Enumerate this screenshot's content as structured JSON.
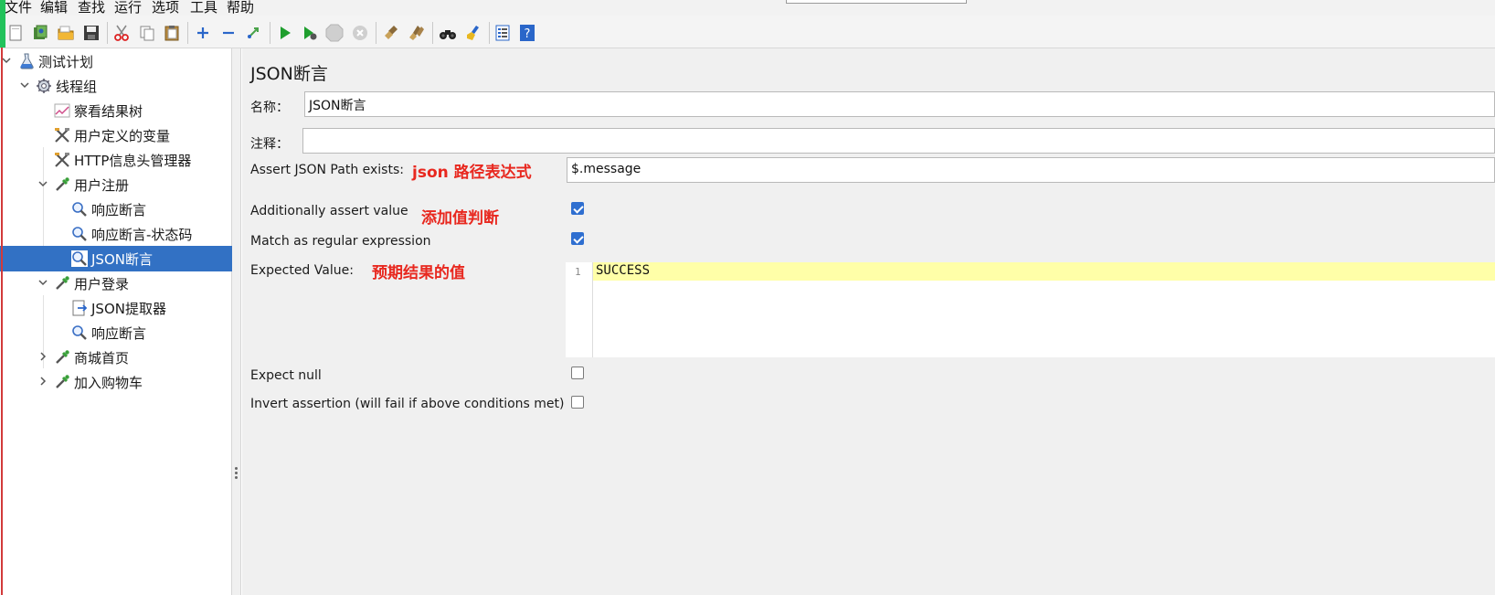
{
  "menu": [
    "文件",
    "编辑",
    "查找",
    "运行",
    "选项",
    "工具",
    "帮助"
  ],
  "toolbar": {
    "icons": [
      "new-icon",
      "templates-icon",
      "open-icon",
      "save-icon",
      "cut-icon",
      "copy-icon",
      "paste-icon",
      "expand-icon",
      "collapse-icon",
      "toggle-icon",
      "start-icon",
      "start-no-pause-icon",
      "stop-icon",
      "shutdown-icon",
      "clear-icon",
      "clear-all-icon",
      "search-icon",
      "reset-search-icon",
      "function-helper-icon",
      "help-icon"
    ]
  },
  "tree": {
    "nodes": [
      {
        "label": "测试计划",
        "icon": "test-plan-icon",
        "level": 0,
        "expanded": true
      },
      {
        "label": "线程组",
        "icon": "thread-group-gear-icon",
        "level": 1,
        "expanded": true
      },
      {
        "label": "察看结果树",
        "icon": "listener-graph-icon",
        "level": 2
      },
      {
        "label": "用户定义的变量",
        "icon": "config-tools-icon",
        "level": 2
      },
      {
        "label": "HTTP信息头管理器",
        "icon": "config-tools-icon",
        "level": 2
      },
      {
        "label": "用户注册",
        "icon": "sampler-pipette-icon",
        "level": 2,
        "expanded": true
      },
      {
        "label": "响应断言",
        "icon": "assertion-magnifier-icon",
        "level": 3
      },
      {
        "label": "响应断言-状态码",
        "icon": "assertion-magnifier-icon",
        "level": 3
      },
      {
        "label": "JSON断言",
        "icon": "assertion-magnifier-icon",
        "level": 3,
        "selected": true
      },
      {
        "label": "用户登录",
        "icon": "sampler-pipette-icon",
        "level": 2,
        "expanded": true
      },
      {
        "label": "JSON提取器",
        "icon": "post-processor-icon",
        "level": 3
      },
      {
        "label": "响应断言",
        "icon": "assertion-magnifier-icon",
        "level": 3
      },
      {
        "label": "商城首页",
        "icon": "sampler-pipette-icon",
        "level": 2,
        "expanded": false
      },
      {
        "label": "加入购物车",
        "icon": "sampler-pipette-icon",
        "level": 2,
        "expanded": false
      }
    ]
  },
  "panel": {
    "title": "JSON断言",
    "name_label": "名称：",
    "name_value": "JSON断言",
    "comment_label": "注释：",
    "comment_value": "",
    "json_path_label": "Assert JSON Path exists:",
    "json_path_value": "$.message",
    "json_path_annotation": "json 路径表达式",
    "assert_value_label": "Additionally assert value",
    "assert_value_checked": true,
    "assert_value_annotation": "添加值判断",
    "regex_label": "Match as regular expression",
    "regex_checked": true,
    "expected_label": "Expected Value:",
    "expected_annotation": "预期结果的值",
    "expected_line_number": "1",
    "expected_value": "SUCCESS",
    "expect_null_label": "Expect null",
    "expect_null_checked": false,
    "invert_label": "Invert assertion (will fail if above conditions met)",
    "invert_checked": false
  },
  "colors": {
    "selection": "#3271c4",
    "annotation": "#e8281f",
    "checkbox_on": "#2f6fd0",
    "highlight_line": "#ffffa8"
  }
}
